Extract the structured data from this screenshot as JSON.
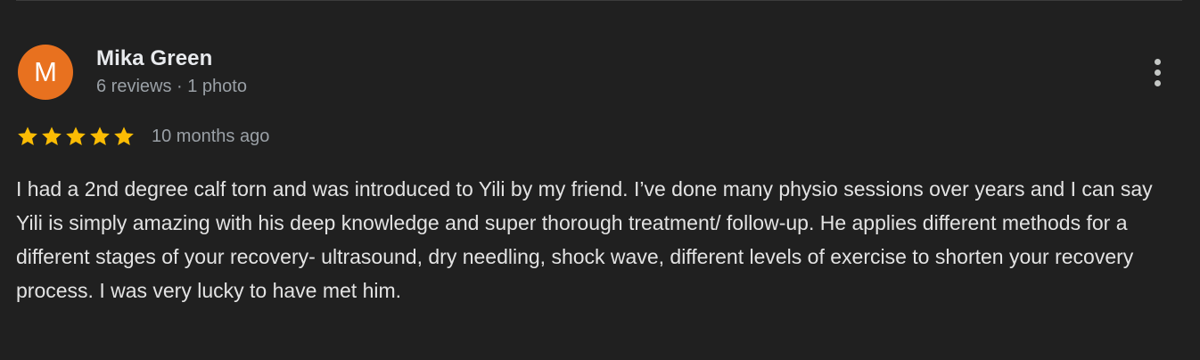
{
  "review": {
    "avatar_initial": "M",
    "reviewer_name": "Mika Green",
    "reviewer_meta": "6 reviews · 1 photo",
    "rating": 5,
    "rating_max": 5,
    "date": "10 months ago",
    "text": "I had a 2nd degree calf torn and was introduced to Yili by my friend. I’ve done many physio sessions over years and I can say Yili is simply amazing with his deep knowledge and super thorough treatment/ follow-up. He applies different methods for a different stages of your recovery- ultrasound, dry needling, shock wave, different levels of exercise to shorten your recovery process. I was very lucky to have met him."
  },
  "icons": {
    "more": "more-vert-icon",
    "star": "star-icon"
  },
  "colors": {
    "background": "#202020",
    "avatar": "#e8711f",
    "star": "#fbbc04",
    "primary_text": "#e8eaed",
    "secondary_text": "#9aa0a6"
  }
}
